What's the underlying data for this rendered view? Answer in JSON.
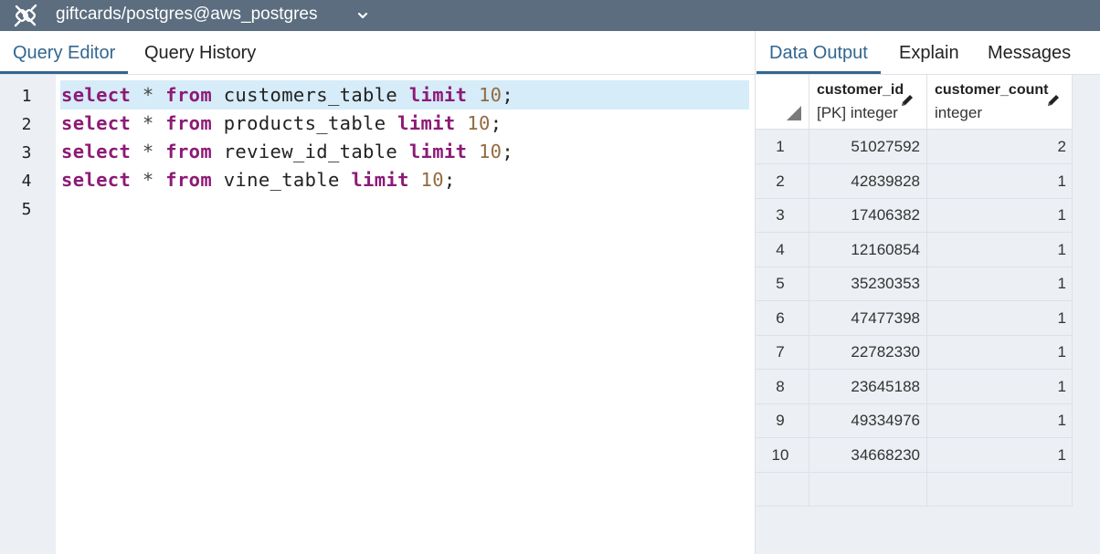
{
  "titlebar": {
    "connection": "giftcards/postgres@aws_postgres",
    "icon": "connection-icon"
  },
  "left_tabs": [
    {
      "label": "Query Editor",
      "active": true
    },
    {
      "label": "Query History",
      "active": false
    }
  ],
  "editor": {
    "line_numbers": [
      "1",
      "2",
      "3",
      "4",
      "5"
    ],
    "lines": [
      [
        {
          "t": "select",
          "c": "kw"
        },
        {
          "t": " ",
          "c": ""
        },
        {
          "t": "*",
          "c": "op"
        },
        {
          "t": " ",
          "c": ""
        },
        {
          "t": "from",
          "c": "kw"
        },
        {
          "t": " customers_table ",
          "c": ""
        },
        {
          "t": "limit",
          "c": "kw"
        },
        {
          "t": " ",
          "c": ""
        },
        {
          "t": "10",
          "c": "num"
        },
        {
          "t": ";",
          "c": ""
        }
      ],
      [
        {
          "t": "select",
          "c": "kw"
        },
        {
          "t": " ",
          "c": ""
        },
        {
          "t": "*",
          "c": "op"
        },
        {
          "t": " ",
          "c": ""
        },
        {
          "t": "from",
          "c": "kw"
        },
        {
          "t": " products_table ",
          "c": ""
        },
        {
          "t": "limit",
          "c": "kw"
        },
        {
          "t": " ",
          "c": ""
        },
        {
          "t": "10",
          "c": "num"
        },
        {
          "t": ";",
          "c": ""
        }
      ],
      [
        {
          "t": "select",
          "c": "kw"
        },
        {
          "t": " ",
          "c": ""
        },
        {
          "t": "*",
          "c": "op"
        },
        {
          "t": " ",
          "c": ""
        },
        {
          "t": "from",
          "c": "kw"
        },
        {
          "t": " review_id_table ",
          "c": ""
        },
        {
          "t": "limit",
          "c": "kw"
        },
        {
          "t": " ",
          "c": ""
        },
        {
          "t": "10",
          "c": "num"
        },
        {
          "t": ";",
          "c": ""
        }
      ],
      [
        {
          "t": "select",
          "c": "kw"
        },
        {
          "t": " ",
          "c": ""
        },
        {
          "t": "*",
          "c": "op"
        },
        {
          "t": " ",
          "c": ""
        },
        {
          "t": "from",
          "c": "kw"
        },
        {
          "t": " vine_table ",
          "c": ""
        },
        {
          "t": "limit",
          "c": "kw"
        },
        {
          "t": " ",
          "c": ""
        },
        {
          "t": "10",
          "c": "num"
        },
        {
          "t": ";",
          "c": ""
        }
      ],
      []
    ],
    "highlight_color": "#d6ecf8"
  },
  "right_tabs": [
    {
      "label": "Data Output",
      "active": true
    },
    {
      "label": "Explain",
      "active": false
    },
    {
      "label": "Messages",
      "active": false
    }
  ],
  "grid": {
    "columns": [
      {
        "name": "customer_id",
        "type": "[PK] integer",
        "icon": "pencil-icon"
      },
      {
        "name": "customer_count",
        "type": "integer",
        "icon": "pencil-icon"
      }
    ],
    "rows": [
      [
        "1",
        "51027592",
        "2"
      ],
      [
        "2",
        "42839828",
        "1"
      ],
      [
        "3",
        "17406382",
        "1"
      ],
      [
        "4",
        "12160854",
        "1"
      ],
      [
        "5",
        "35230353",
        "1"
      ],
      [
        "6",
        "47477398",
        "1"
      ],
      [
        "7",
        "22782330",
        "1"
      ],
      [
        "8",
        "23645188",
        "1"
      ],
      [
        "9",
        "49334976",
        "1"
      ],
      [
        "10",
        "34668230",
        "1"
      ]
    ]
  },
  "colors": {
    "titlebar": "#5b6d7e",
    "accent": "#326690",
    "keyword": "#8d1a76",
    "number": "#936a41"
  }
}
